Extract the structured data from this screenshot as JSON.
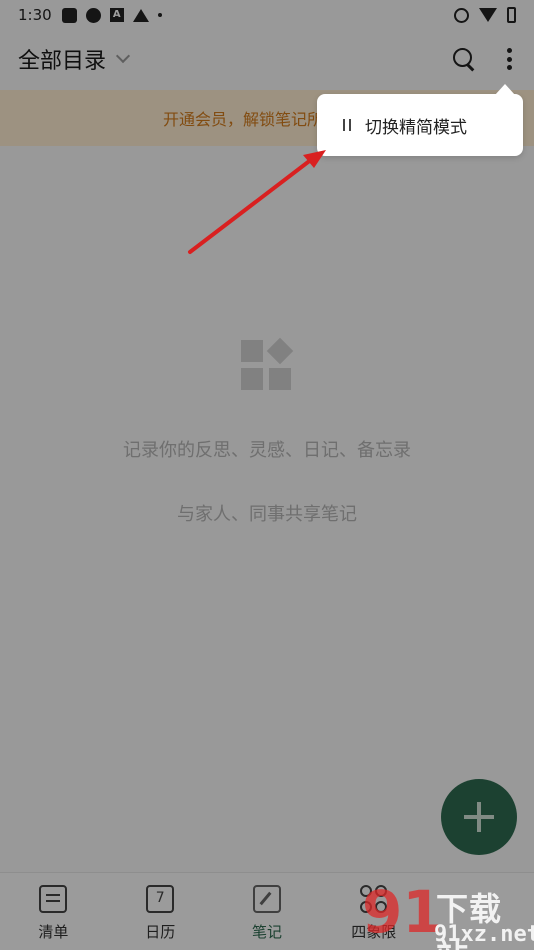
{
  "status_bar": {
    "time": "1:30"
  },
  "header": {
    "title": "全部目录"
  },
  "banner": {
    "text": "开通会员，解锁笔记所有功能"
  },
  "empty_state": {
    "line1": "记录你的反思、灵感、日记、备忘录",
    "line2": "与家人、同事共享笔记"
  },
  "calendar": {
    "day": "7"
  },
  "bottom_nav": [
    {
      "label": "清单",
      "icon": "checklist-icon"
    },
    {
      "label": "日历",
      "icon": "calendar-icon"
    },
    {
      "label": "笔记",
      "icon": "note-icon",
      "active": true
    },
    {
      "label": "四象限",
      "icon": "quadrant-icon"
    }
  ],
  "popup_menu": {
    "items": [
      {
        "label": "切换精简模式",
        "icon": "sort-icon"
      }
    ]
  },
  "annotation": {
    "color": "#d92020"
  },
  "watermark": {
    "logo": "91",
    "title": "下载站",
    "url": "91xz.net"
  },
  "colors": {
    "accent": "#2e6a4f",
    "banner_text": "#d27b1c",
    "banner_bg": "#fdecd0"
  }
}
